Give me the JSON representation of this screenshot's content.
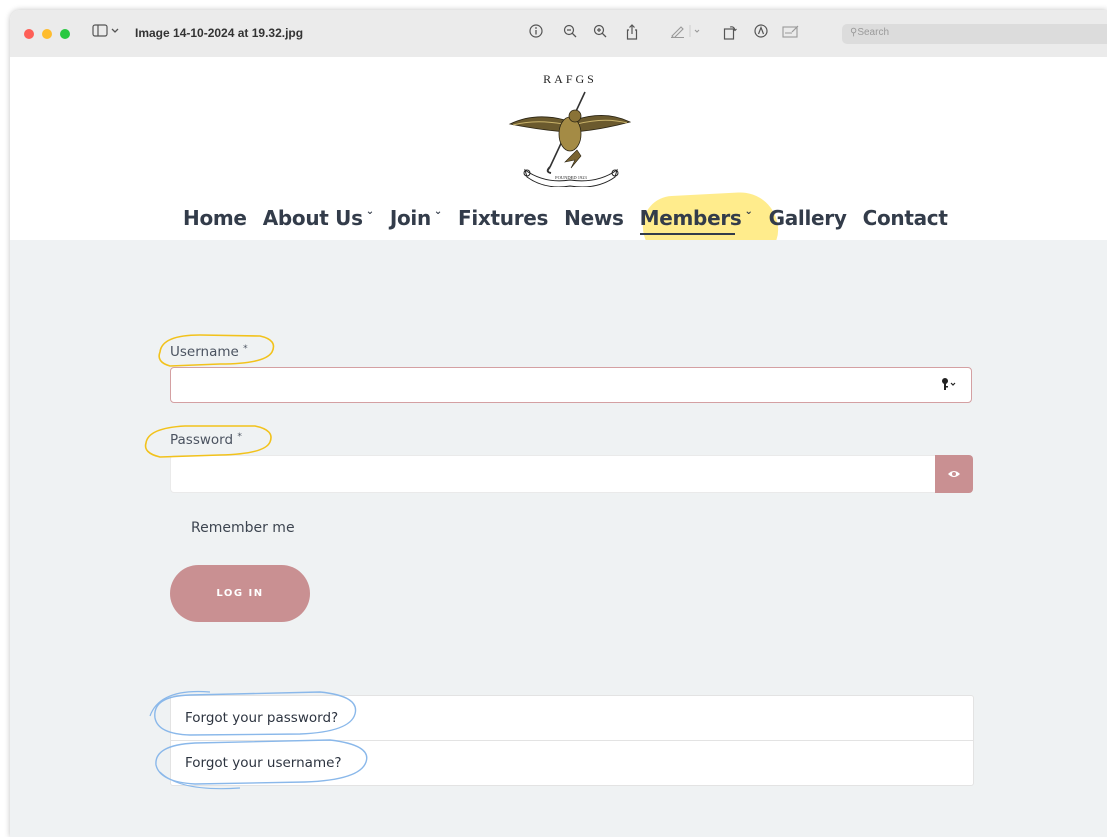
{
  "window": {
    "title": "Image 14-10-2024 at 19.32.jpg",
    "search_placeholder": "Search"
  },
  "site": {
    "logo_text": "RAFGS",
    "logo_motto": "FOUNDED 1923"
  },
  "nav": {
    "items": [
      {
        "label": "Home",
        "has_dropdown": false
      },
      {
        "label": "About Us",
        "has_dropdown": true
      },
      {
        "label": "Join",
        "has_dropdown": true
      },
      {
        "label": "Fixtures",
        "has_dropdown": false
      },
      {
        "label": "News",
        "has_dropdown": false
      },
      {
        "label": "Members",
        "has_dropdown": true
      },
      {
        "label": "Gallery",
        "has_dropdown": false
      },
      {
        "label": "Contact",
        "has_dropdown": false
      }
    ]
  },
  "form": {
    "username_label": "Username",
    "password_label": "Password",
    "required_mark": "*",
    "username_value": "",
    "password_value": "",
    "remember_label": "Remember me",
    "remember_checked": false,
    "login_button": "LOG IN"
  },
  "links": {
    "forgot_password": "Forgot your password?",
    "forgot_username": "Forgot your username?"
  },
  "colors": {
    "accent": "#c99092",
    "nav_text": "#333c4a",
    "page_bg": "#eff2f3",
    "highlight_yellow": "#ffdd2d",
    "highlight_blue": "#9fc6ee"
  }
}
